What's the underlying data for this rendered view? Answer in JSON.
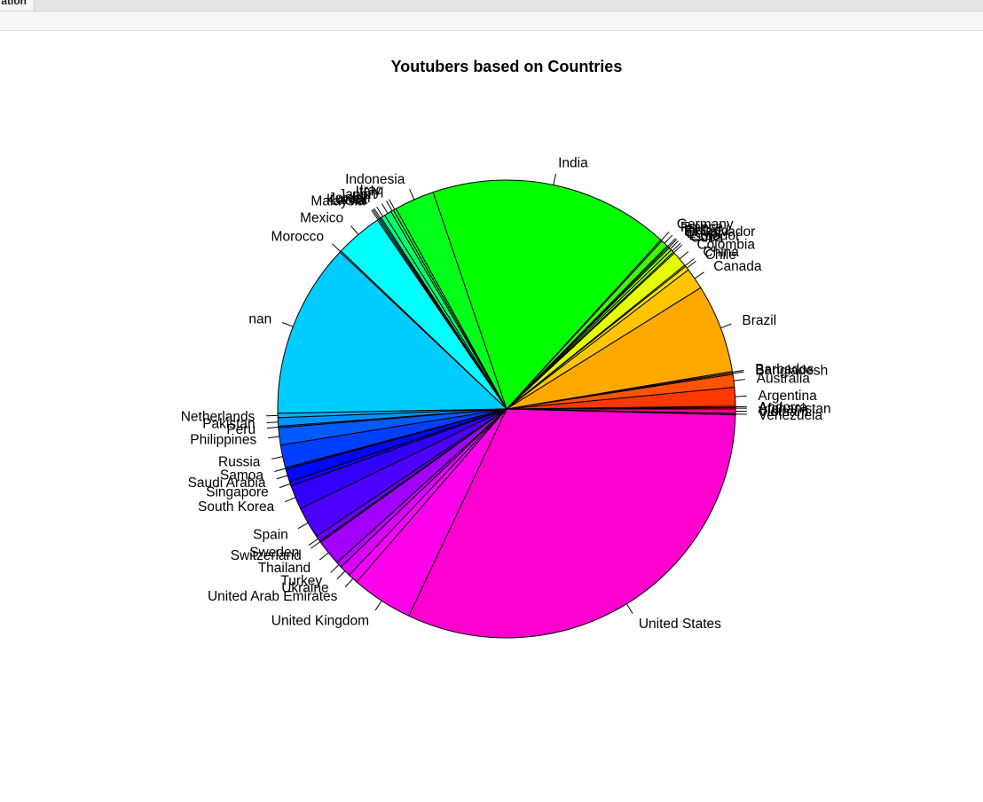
{
  "window": {
    "tab_label": "ation"
  },
  "chart_data": {
    "type": "pie",
    "title": "Youtubers based on Countries",
    "start": "3 o'clock",
    "direction": "counterclockwise",
    "border_color": "#000000",
    "slices": [
      {
        "label": "Afghanistan",
        "value": 1
      },
      {
        "label": "Andorra",
        "value": 1
      },
      {
        "label": "Argentina",
        "value": 13
      },
      {
        "label": "Australia",
        "value": 9
      },
      {
        "label": "Bangladesh",
        "value": 1
      },
      {
        "label": "Barbados",
        "value": 1
      },
      {
        "label": "Brazil",
        "value": 62
      },
      {
        "label": "Canada",
        "value": 15
      },
      {
        "label": "Chile",
        "value": 3
      },
      {
        "label": "China",
        "value": 1
      },
      {
        "label": "Colombia",
        "value": 11
      },
      {
        "label": "Cuba",
        "value": 1
      },
      {
        "label": "Ecuador",
        "value": 2
      },
      {
        "label": "Egypt",
        "value": 2
      },
      {
        "label": "El Salvador",
        "value": 1
      },
      {
        "label": "Finland",
        "value": 1
      },
      {
        "label": "France",
        "value": 5
      },
      {
        "label": "Germany",
        "value": 1
      },
      {
        "label": "India",
        "value": 168
      },
      {
        "label": "Indonesia",
        "value": 28
      },
      {
        "label": "Iraq",
        "value": 2
      },
      {
        "label": "Italy",
        "value": 2
      },
      {
        "label": "Japan",
        "value": 5
      },
      {
        "label": "Jordan",
        "value": 3
      },
      {
        "label": "Kuwait",
        "value": 1
      },
      {
        "label": "Latvia",
        "value": 1
      },
      {
        "label": "Malaysia",
        "value": 1
      },
      {
        "label": "Mexico",
        "value": 33
      },
      {
        "label": "Morocco",
        "value": 1
      },
      {
        "label": "nan",
        "value": 122
      },
      {
        "label": "Netherlands",
        "value": 3
      },
      {
        "label": "Pakistan",
        "value": 6
      },
      {
        "label": "Peru",
        "value": 1
      },
      {
        "label": "Philippines",
        "value": 12
      },
      {
        "label": "Russia",
        "value": 16
      },
      {
        "label": "Samoa",
        "value": 1
      },
      {
        "label": "Saudi Arabia",
        "value": 9
      },
      {
        "label": "Singapore",
        "value": 3
      },
      {
        "label": "South Korea",
        "value": 17
      },
      {
        "label": "Spain",
        "value": 22
      },
      {
        "label": "Sweden",
        "value": 4
      },
      {
        "label": "Switzerland",
        "value": 1
      },
      {
        "label": "Thailand",
        "value": 18
      },
      {
        "label": "Turkey",
        "value": 4
      },
      {
        "label": "Ukraine",
        "value": 8
      },
      {
        "label": "United Arab Emirates",
        "value": 7
      },
      {
        "label": "United Kingdom",
        "value": 43
      },
      {
        "label": "United States",
        "value": 313
      },
      {
        "label": "Venezuela",
        "value": 1
      },
      {
        "label": "Vietnam",
        "value": 3
      }
    ]
  }
}
